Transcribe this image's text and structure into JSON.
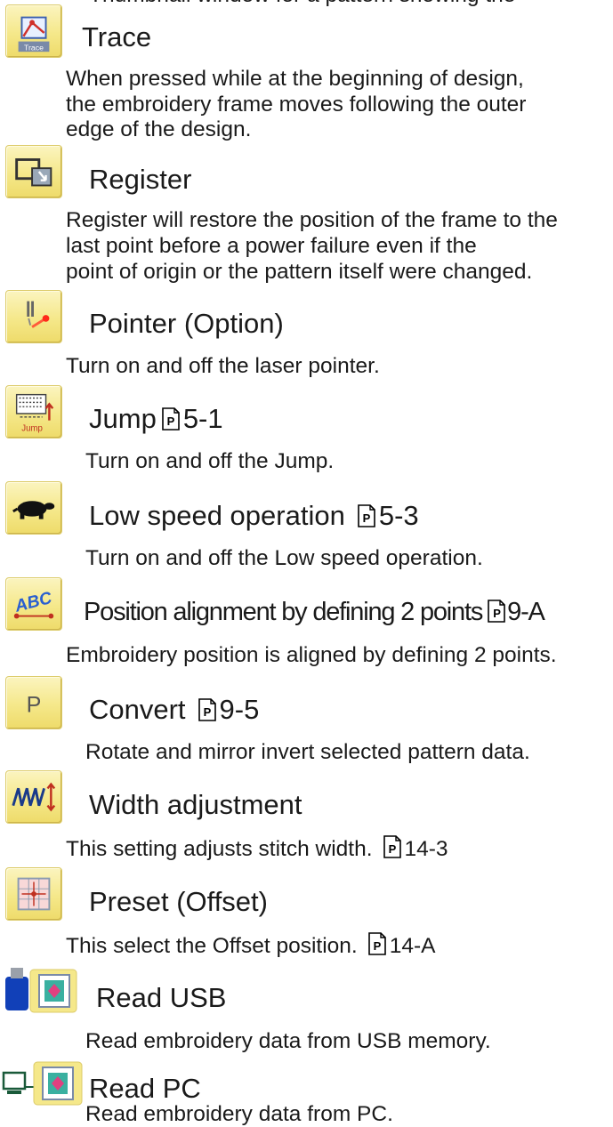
{
  "partial_line": "Thumbnail window for a pattern showing the",
  "items": [
    {
      "title": "Trace",
      "icon": "trace-icon",
      "desc": [
        "When pressed while at the beginning of design,",
        "the embroidery frame moves following the outer",
        "edge of the design."
      ]
    },
    {
      "title": "Register",
      "icon": "register-icon",
      "desc": [
        "Register will restore the position of the frame to the",
        "last point before a power failure even if the",
        "point of origin or the pattern itself were changed."
      ]
    },
    {
      "title": "Pointer (Option)",
      "icon": "pointer-icon",
      "desc": [
        "Turn on and off the laser pointer."
      ]
    },
    {
      "title": "Jump",
      "ref": "5-1",
      "icon": "jump-icon",
      "desc": [
        "Turn on and off the Jump."
      ]
    },
    {
      "title": "Low speed operation",
      "ref": "5-3",
      "icon": "turtle-icon",
      "desc": [
        "Turn on and off the Low speed operation."
      ]
    },
    {
      "title": "Position alignment by defining 2 points",
      "ref": "9-A",
      "icon": "abc-alignment-icon",
      "desc": [
        "Embroidery position is aligned by defining 2 points."
      ]
    },
    {
      "title": "Convert",
      "ref": "9-5",
      "icon": "convert-p-icon",
      "desc": [
        "Rotate and mirror invert selected pattern data."
      ]
    },
    {
      "title": "Width adjustment",
      "icon": "width-adjust-icon",
      "desc": [
        "This setting adjusts stitch width."
      ],
      "desc_ref": "14-3"
    },
    {
      "title": "Preset (Offset)",
      "icon": "preset-offset-icon",
      "desc": [
        "This select the Offset position."
      ],
      "desc_ref": "14-A"
    },
    {
      "title": "Read USB",
      "icon": "usb-read-icon",
      "desc": [
        "Read embroidery data from USB memory."
      ]
    },
    {
      "title": "Read PC",
      "icon": "pc-read-icon",
      "desc": [
        "Read embroidery data from PC."
      ]
    }
  ],
  "reference_icon": "page-reference-p-icon",
  "colors": {
    "icon_bg": "#f5e88a",
    "icon_border": "#dccb6a",
    "text": "#1a1a1a"
  }
}
